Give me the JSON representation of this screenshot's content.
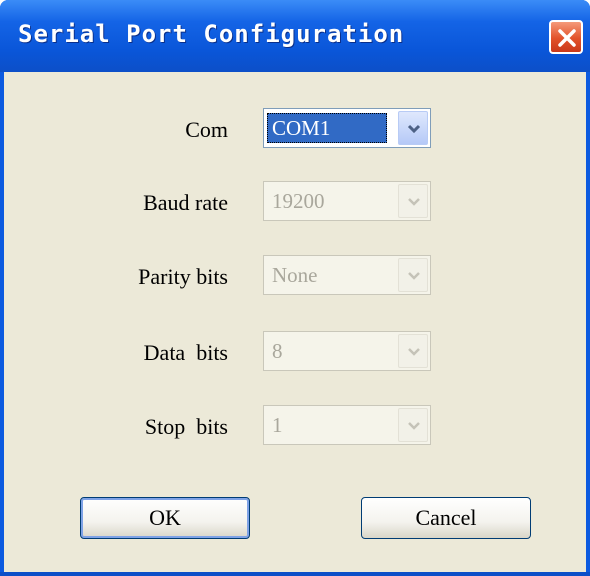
{
  "window": {
    "title": "Serial Port Configuration",
    "close_icon": "close-x-icon"
  },
  "fields": [
    {
      "label": "Com",
      "value": "COM1",
      "enabled": true
    },
    {
      "label": "Baud rate",
      "value": "19200",
      "enabled": false
    },
    {
      "label": "Parity bits",
      "value": "None",
      "enabled": false
    },
    {
      "label": "Data  bits",
      "value": "8",
      "enabled": false
    },
    {
      "label": "Stop  bits",
      "value": "1",
      "enabled": false
    }
  ],
  "buttons": {
    "ok_label": "OK",
    "cancel_label": "Cancel"
  },
  "colors": {
    "titlebar": "#0a56d9",
    "client": "#ece9d8",
    "selection": "#316ac5",
    "close": "#e2522a",
    "disabled_text": "#a9a79c"
  }
}
